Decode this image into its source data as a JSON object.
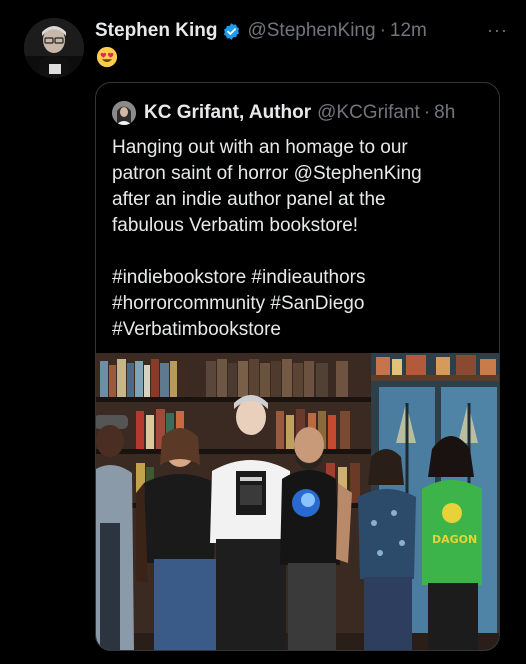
{
  "tweet": {
    "author_name": "Stephen King",
    "author_handle": "@StephenKing",
    "separator": "·",
    "time": "12m",
    "more_label": "···",
    "emoji": "heart-eyes-emoji",
    "verified_color": "#1d9bf0"
  },
  "quote": {
    "author_name": "KC Grifant, Author",
    "author_handle": "@KCGrifant",
    "separator": "·",
    "time": "8h",
    "text_lines": [
      "Hanging out with an homage to our",
      "patron saint of horror @StephenKing",
      "after an indie author panel at the",
      "fabulous Verbatim bookstore!",
      "",
      "#indiebookstore #indieauthors",
      "#horrorcommunity #SanDiego",
      "#Verbatimbookstore"
    ],
    "photo_shirt_text": "DAGON"
  }
}
